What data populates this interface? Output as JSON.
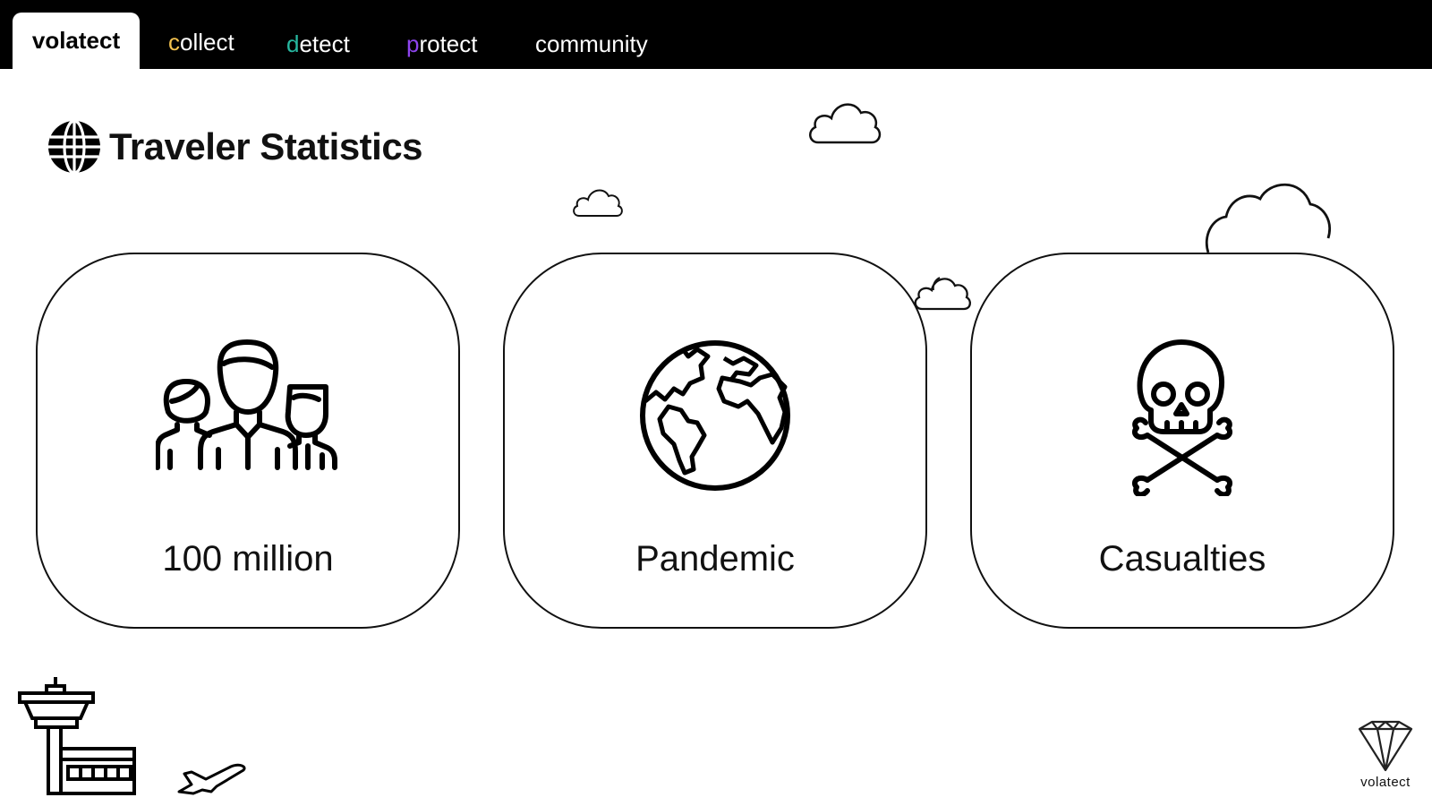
{
  "nav": {
    "tabs": [
      {
        "label": "volatect",
        "active": true
      },
      {
        "label": "collect",
        "accent_letter": "c",
        "rest": "ollect",
        "accent_color": "#f2c14e"
      },
      {
        "label": "detect",
        "accent_letter": "d",
        "rest": "etect",
        "accent_color": "#27b8a0"
      },
      {
        "label": "protect",
        "accent_letter": "p",
        "rest": "rotect",
        "accent_color": "#8e44ef"
      },
      {
        "label": "community"
      }
    ]
  },
  "page": {
    "title": "Traveler Statistics",
    "title_icon": "globe-icon"
  },
  "cards": [
    {
      "label": "100 million",
      "icon": "people-group-icon"
    },
    {
      "label": "Pandemic",
      "icon": "earth-icon"
    },
    {
      "label": "Casualties",
      "icon": "skull-crossbones-icon"
    }
  ],
  "decorations": {
    "clouds": [
      "cloud-icon",
      "cloud-icon",
      "cloud-icon",
      "cloud-icon"
    ],
    "bottom_left": [
      "control-tower-icon",
      "airplane-icon"
    ]
  },
  "logo": {
    "text": "volatect",
    "icon": "diamond-logo-icon"
  }
}
